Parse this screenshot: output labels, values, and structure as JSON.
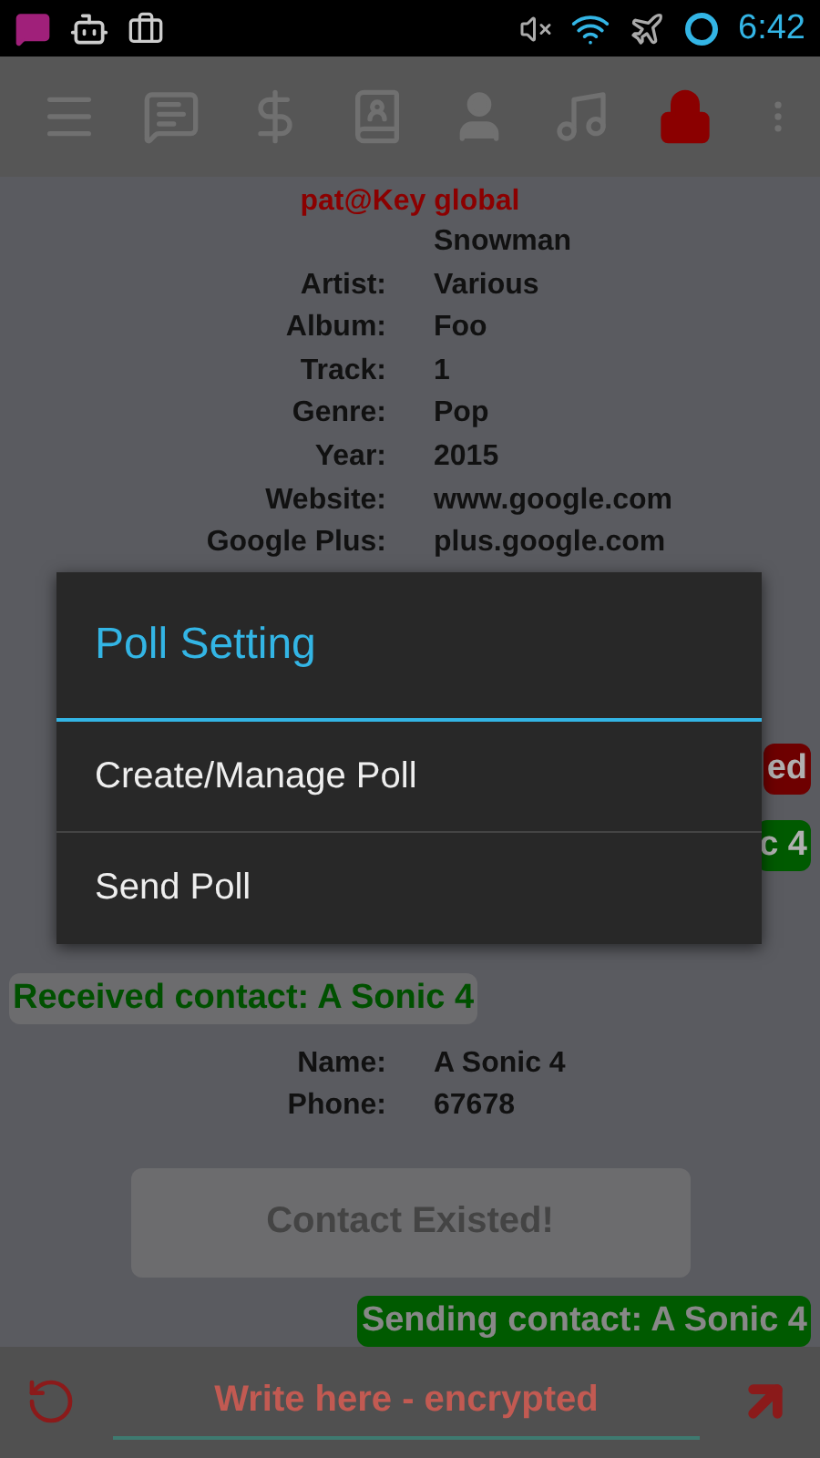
{
  "status_bar": {
    "time": "6:42"
  },
  "toolbar": {
    "items": [
      {
        "kind": "menu",
        "active": false
      },
      {
        "kind": "chat",
        "active": false
      },
      {
        "kind": "dollar",
        "active": false
      },
      {
        "kind": "contacts",
        "active": false
      },
      {
        "kind": "person",
        "active": false
      },
      {
        "kind": "music",
        "active": false
      },
      {
        "kind": "lock",
        "active": true
      },
      {
        "kind": "overflow",
        "active": false
      }
    ]
  },
  "header": "pat@Key global",
  "song_fields": [
    {
      "value": "Snowman"
    },
    {
      "label": "Artist:",
      "value": "Various"
    },
    {
      "label": "Album:",
      "value": "Foo"
    },
    {
      "label": "Track:",
      "value": "1"
    },
    {
      "label": "Genre:",
      "value": "Pop"
    },
    {
      "label": "Year:",
      "value": "2015"
    },
    {
      "label": "Website:",
      "value": "www.google.com"
    },
    {
      "label": "Google Plus:",
      "value": "plus.google.com"
    }
  ],
  "hidden_bubbles": [
    {
      "text": "ed",
      "color": "#6e0000"
    },
    {
      "text": "c 4",
      "color": "#005a00"
    }
  ],
  "received": "Received contact: A Sonic 4",
  "contact_fields": [
    {
      "label": "Name:",
      "value": "A Sonic 4"
    },
    {
      "label": "Phone:",
      "value": "67678"
    }
  ],
  "contact_button": "Contact Existed!",
  "sending": "Sending contact: A Sonic 4",
  "composer": {
    "placeholder": "Write here - encrypted"
  },
  "dialog": {
    "title": "Poll Setting",
    "items": [
      "Create/Manage Poll",
      "Send Poll"
    ]
  }
}
